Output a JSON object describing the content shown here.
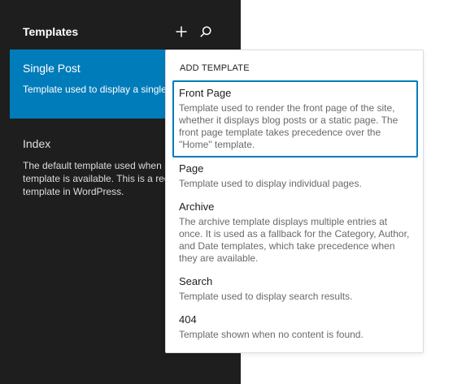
{
  "sidebar": {
    "title": "Templates",
    "add_icon": "plus-icon",
    "search_icon": "search-icon",
    "items": [
      {
        "title": "Single Post",
        "description": "Template used to display a single blog post."
      },
      {
        "title": "Index",
        "description": "The default template used when no other template is available. This is a required template in WordPress."
      }
    ]
  },
  "dropdown": {
    "heading": "ADD TEMPLATE",
    "options": [
      {
        "label": "Front Page",
        "description": "Template used to render the front page of the site, whether it displays blog posts or a static page. The front page template takes precedence over the \"Home\" template."
      },
      {
        "label": "Page",
        "description": "Template used to display individual pages."
      },
      {
        "label": "Archive",
        "description": "The archive template displays multiple entries at once. It is used as a fallback for the Category, Author, and Date templates, which take precedence when they are available."
      },
      {
        "label": "Search",
        "description": "Template used to display search results."
      },
      {
        "label": "404",
        "description": "Template shown when no content is found."
      }
    ]
  },
  "colors": {
    "sidebar_bg": "#1e1e1e",
    "accent": "#007cba",
    "text_dark": "#1e1e1e",
    "text_muted": "#6a6a6a"
  }
}
